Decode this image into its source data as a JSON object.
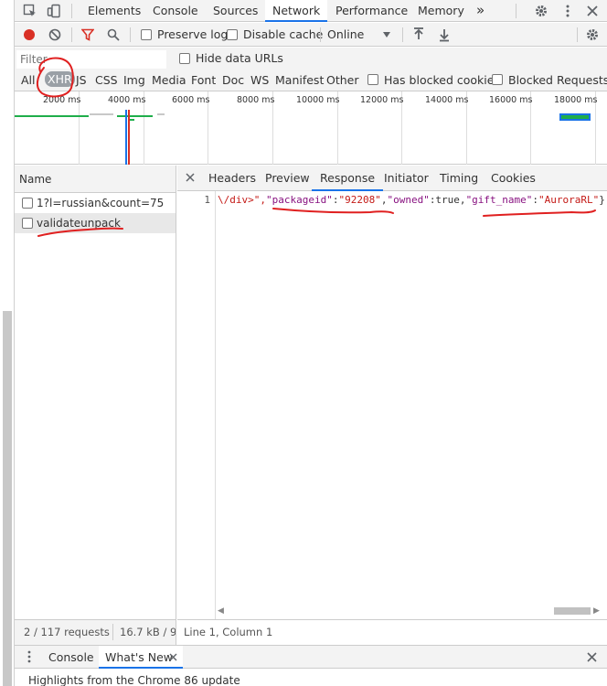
{
  "devtools": {
    "tabs": [
      {
        "label": "Elements"
      },
      {
        "label": "Console"
      },
      {
        "label": "Sources"
      },
      {
        "label": "Network"
      },
      {
        "label": "Performance"
      },
      {
        "label": "Memory"
      }
    ],
    "more_tabs": "»"
  },
  "toolbar": {
    "preserve_log": "Preserve log",
    "disable_cache": "Disable cache",
    "throttle": "Online"
  },
  "filter": {
    "placeholder": "Filter",
    "hide_data_urls": "Hide data URLs",
    "types": [
      "All",
      "XHR",
      "JS",
      "CSS",
      "Img",
      "Media",
      "Font",
      "Doc",
      "WS",
      "Manifest",
      "Other"
    ],
    "active_type": "XHR",
    "has_blocked_cookies": "Has blocked cookies",
    "blocked_requests": "Blocked Requests"
  },
  "timeline": {
    "ticks": [
      "2000 ms",
      "4000 ms",
      "6000 ms",
      "8000 ms",
      "10000 ms",
      "12000 ms",
      "14000 ms",
      "16000 ms",
      "18000 ms"
    ]
  },
  "requests": {
    "header": "Name",
    "rows": [
      {
        "name": "1?l=russian&count=75"
      },
      {
        "name": "validateunpack"
      }
    ]
  },
  "detail": {
    "tabs": [
      {
        "label": "Headers"
      },
      {
        "label": "Preview"
      },
      {
        "label": "Response"
      },
      {
        "label": "Initiator"
      },
      {
        "label": "Timing"
      },
      {
        "label": "Cookies"
      }
    ],
    "line_number": "1",
    "response": {
      "p1": "\\/div>\",",
      "k1": "\"packageid\"",
      "c1": ":",
      "v1": "\"92208\"",
      "c2": ",",
      "k2": "\"owned\"",
      "c3": ":true,",
      "k3": "\"gift_name\"",
      "c4": ":",
      "v3": "\"AuroraRL\"",
      "c5": "}"
    }
  },
  "status": {
    "requests": "2 / 117 requests",
    "transferred": "16.7 kB / 9",
    "cursor": "Line 1, Column 1"
  },
  "drawer": {
    "tabs": [
      {
        "label": "Console"
      },
      {
        "label": "What's New"
      }
    ],
    "body": "Highlights from the Chrome 86 update"
  }
}
